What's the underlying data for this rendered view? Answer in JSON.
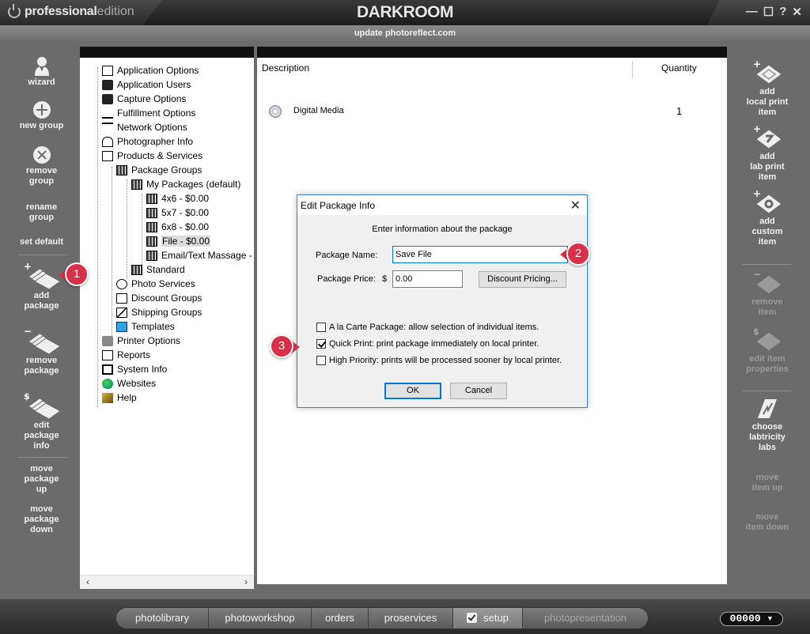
{
  "title_bar": {
    "brand_bold": "professional",
    "brand_light": "edition",
    "app_name": "DARKROOM",
    "window_buttons": [
      "—",
      "☐",
      "?",
      "✕"
    ]
  },
  "sub_bar": {
    "text": "update photoreflect.com"
  },
  "left_panel": {
    "wizard": "wizard",
    "new_group": "new group",
    "remove_group": [
      "remove",
      "group"
    ],
    "rename_group": [
      "rename",
      "group"
    ],
    "set_default": "set default",
    "add_package": [
      "add",
      "package"
    ],
    "remove_package": [
      "remove",
      "package"
    ],
    "edit_package_info": [
      "edit",
      "package",
      "info"
    ],
    "move_package_up": [
      "move",
      "package",
      "up"
    ],
    "move_package_down": [
      "move",
      "package",
      "down"
    ]
  },
  "right_panel": {
    "add_local_print_item": [
      "add",
      "local print",
      "item"
    ],
    "add_lab_print_item": [
      "add",
      "lab print",
      "item"
    ],
    "add_custom_item": [
      "add",
      "custom",
      "item"
    ],
    "remove_item": [
      "remove",
      "item"
    ],
    "edit_item_properties": [
      "edit item",
      "properties"
    ],
    "choose_labtricity_labs": [
      "choose",
      "labtricity",
      "labs"
    ],
    "move_item_up": [
      "move",
      "item up"
    ],
    "move_item_down": [
      "move",
      "item down"
    ]
  },
  "tree": {
    "application_options": "Application Options",
    "application_users": "Application Users",
    "capture_options": "Capture Options",
    "fulfillment_options": "Fulfillment Options",
    "network_options": "Network Options",
    "photographer_info": "Photographer Info",
    "products_services": "Products & Services",
    "package_groups": "Package Groups",
    "my_packages": "My Packages (default)",
    "pkg_4x6": "4x6 - $0.00",
    "pkg_5x7": "5x7 - $0.00",
    "pkg_6x8": "6x8 - $0.00",
    "pkg_file": "File - $0.00",
    "pkg_email": "Email/Text Massage -",
    "standard": "Standard",
    "photo_services": "Photo Services",
    "discount_groups": "Discount Groups",
    "shipping_groups": "Shipping Groups",
    "templates": "Templates",
    "printer_options": "Printer Options",
    "reports": "Reports",
    "system_info": "System Info",
    "websites": "Websites",
    "help": "Help"
  },
  "items_table": {
    "col_description": "Description",
    "col_quantity": "Quantity",
    "rows": [
      {
        "description": "Digital Media",
        "quantity": "1"
      }
    ]
  },
  "dialog": {
    "title": "Edit Package Info",
    "close": "✕",
    "instructions": "Enter information about the package",
    "package_name_label": "Package Name:",
    "package_name_value": "Save File",
    "package_price_label": "Package Price:",
    "currency": "$",
    "package_price_value": "0.00",
    "discount_button": "Discount Pricing...",
    "a_la_carte": "A la Carte Package: allow selection of individual items.",
    "quick_print": "Quick Print: print package immediately on local printer.",
    "high_priority": "High Priority: prints will be processed sooner by local printer.",
    "ok": "OK",
    "cancel": "Cancel"
  },
  "callouts": [
    "1",
    "2",
    "3"
  ],
  "bottom_tabs": {
    "photolibrary": "photolibrary",
    "photoworkshop": "photoworkshop",
    "orders": "orders",
    "proservices": "proservices",
    "setup": "setup",
    "photopresentation": "photopresentation"
  },
  "counter": "00000 ▾"
}
